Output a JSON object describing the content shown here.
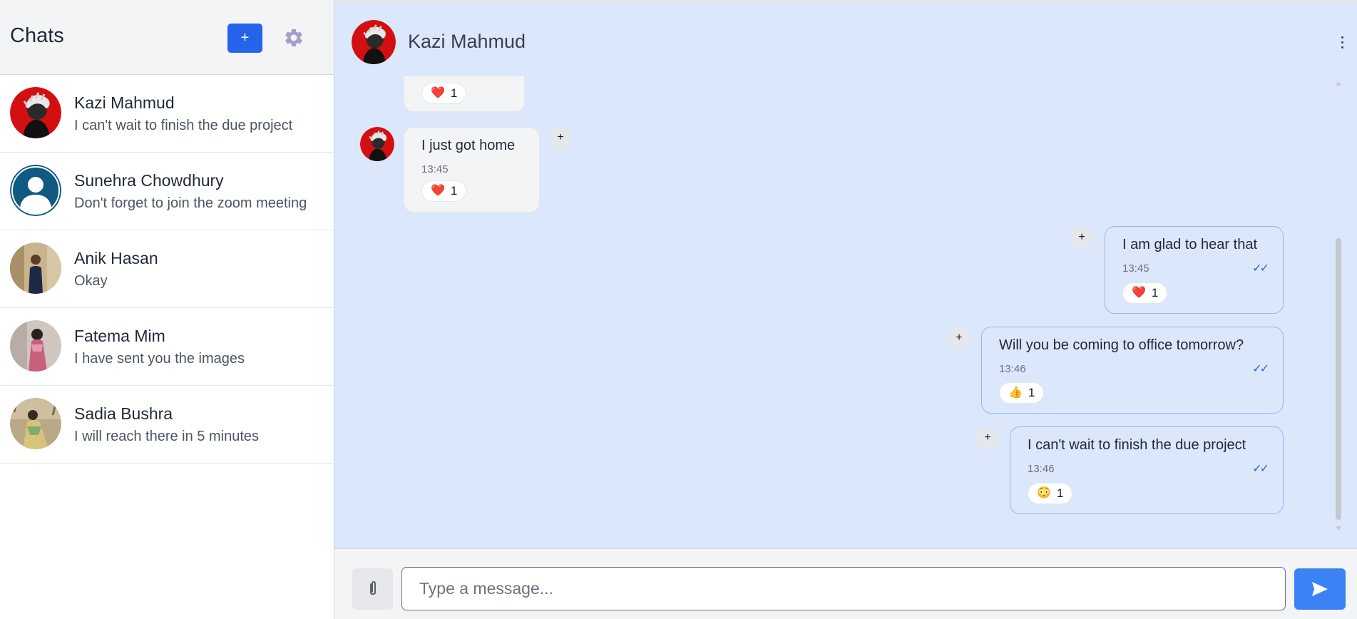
{
  "sidebar": {
    "title": "Chats",
    "new_chat_label": "+",
    "chats": [
      {
        "name": "Kazi Mahmud",
        "preview": "I can't wait to finish the due project"
      },
      {
        "name": "Sunehra Chowdhury",
        "preview": "Don't forget to join the zoom meeting"
      },
      {
        "name": "Anik Hasan",
        "preview": "Okay"
      },
      {
        "name": "Fatema Mim",
        "preview": "I have sent you the images"
      },
      {
        "name": "Sadia Bushra",
        "preview": "I will reach there in 5 minutes"
      }
    ]
  },
  "conversation": {
    "contact_name": "Kazi Mahmud",
    "messages": [
      {
        "direction": "in",
        "text": "",
        "time": "",
        "reaction_emoji": "❤️",
        "reaction_count": "1"
      },
      {
        "direction": "in",
        "text": "I just got home",
        "time": "13:45",
        "reaction_emoji": "❤️",
        "reaction_count": "1"
      },
      {
        "direction": "out",
        "text": "I am glad to hear that",
        "time": "13:45",
        "ticks": "✓✓",
        "reaction_emoji": "❤️",
        "reaction_count": "1"
      },
      {
        "direction": "out",
        "text": "Will you be coming to office tomorrow?",
        "time": "13:46",
        "ticks": "✓✓",
        "reaction_emoji": "👍",
        "reaction_count": "1"
      },
      {
        "direction": "out",
        "text": "I can't wait to finish the due project",
        "time": "13:46",
        "ticks": "✓✓",
        "reaction_emoji": "😳",
        "reaction_count": "1"
      }
    ],
    "add_reaction_label": "+"
  },
  "composer": {
    "placeholder": "Type a message...",
    "value": ""
  },
  "colors": {
    "accent": "#2563eb",
    "send_button": "#3b82f6",
    "chat_background": "#dbe8fb",
    "sidebar_header": "#f3f4f6"
  },
  "icons": {
    "settings": "gear-icon",
    "more": "kebab-menu-icon",
    "attach": "paperclip-icon",
    "send": "send-icon"
  }
}
